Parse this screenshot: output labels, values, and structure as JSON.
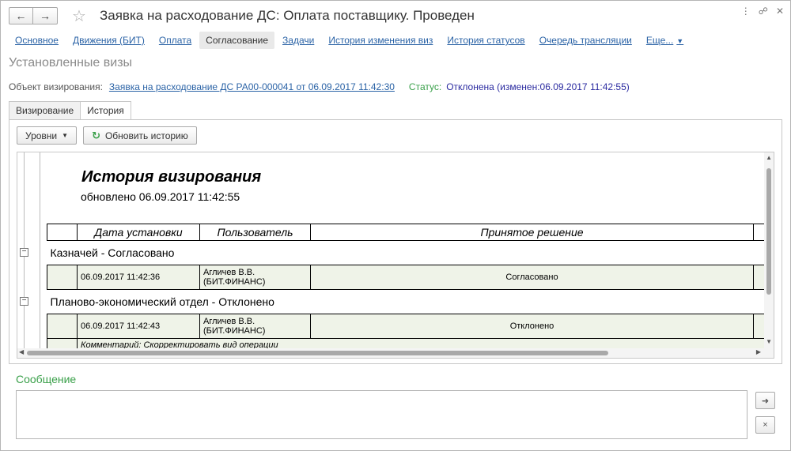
{
  "header": {
    "back_icon": "arrow-left-icon",
    "forward_icon": "arrow-right-icon",
    "star_icon": "star-icon",
    "title": "Заявка на расходование ДС: Оплата поставщику. Проведен",
    "more_icon": "more-icon",
    "link_icon": "link-icon",
    "close_icon": "close-icon"
  },
  "links": [
    {
      "label": "Основное"
    },
    {
      "label": "Движения (БИТ)"
    },
    {
      "label": "Оплата"
    },
    {
      "label": "Согласование"
    },
    {
      "label": "Задачи"
    },
    {
      "label": "История изменения виз"
    },
    {
      "label": "История статусов"
    },
    {
      "label": "Очередь трансляции"
    },
    {
      "label": "Еще..."
    }
  ],
  "section_title": "Установленные визы",
  "object": {
    "label": "Объект визирования:",
    "value": "Заявка на расходование ДС РА00-000041 от 06.09.2017 11:42:30",
    "status_label": "Статус:",
    "status_value": "Отклонена (изменен:06.09.2017 11:42:55)"
  },
  "inner_tabs": [
    {
      "label": "Визирование"
    },
    {
      "label": "История"
    }
  ],
  "toolbar": {
    "levels_label": "Уровни",
    "refresh_label": "Обновить историю"
  },
  "report": {
    "title": "История визирования",
    "subtitle": "обновлено 06.09.2017 11:42:55",
    "columns": [
      "Дата установки",
      "Пользователь",
      "Принятое решение"
    ],
    "groups": [
      {
        "name": "Казначей - Согласовано",
        "rows": [
          {
            "date": "06.09.2017 11:42:36",
            "user_line1": "Агличев В.В.",
            "user_line2": "(БИТ.ФИНАНС)",
            "decision": "Согласовано"
          }
        ]
      },
      {
        "name": "Планово-экономический отдел - Отклонено",
        "rows": [
          {
            "date": "06.09.2017 11:42:43",
            "user_line1": "Агличев В.В.",
            "user_line2": "(БИТ.ФИНАНС)",
            "decision": "Отклонено"
          }
        ],
        "comment": "Комментарий: Скорректировать вид операции"
      }
    ]
  },
  "message": {
    "label": "Сообщение",
    "send_icon": "send-icon",
    "clear_icon": "clear-icon"
  },
  "colors": {
    "link": "#2b63a6",
    "status_label": "#3aa04a",
    "status_value": "#2a2aa0",
    "row_bg": "#eff3e8"
  }
}
